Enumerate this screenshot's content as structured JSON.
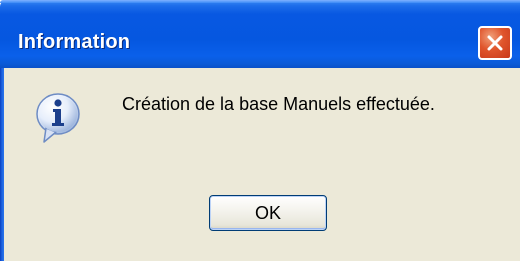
{
  "window": {
    "title": "Information"
  },
  "dialog": {
    "message": "Création de la base Manuels effectuée.",
    "ok_label": "OK"
  },
  "icons": {
    "close": "close-icon",
    "info": "information-icon"
  },
  "colors": {
    "titlebar": "#0557e0",
    "close_button": "#e0552c",
    "client_background": "#ece9d8",
    "button_border": "#003c74"
  }
}
